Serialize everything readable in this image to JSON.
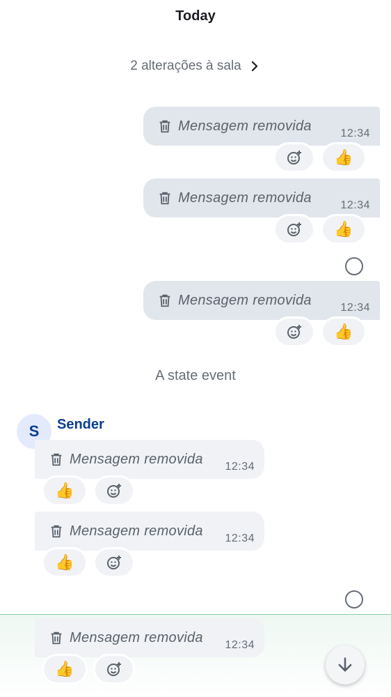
{
  "timeline": {
    "day_divider": "Today",
    "room_changes": "2 alterações à sala",
    "state_event": "A state event",
    "sender_name": "Sender",
    "sender_initial": "S"
  },
  "messages": [
    {
      "text": "Mensagem removida",
      "time": "12:34",
      "reaction": "👍"
    },
    {
      "text": "Mensagem removida",
      "time": "12:34",
      "reaction": "👍"
    },
    {
      "text": "Mensagem removida",
      "time": "12:34",
      "reaction": "👍"
    },
    {
      "text": "Mensagem removida",
      "time": "12:34",
      "reaction": "👍"
    },
    {
      "text": "Mensagem removida",
      "time": "12:34",
      "reaction": "👍"
    },
    {
      "text": "Mensagem removida",
      "time": "12:34",
      "reaction": "👍"
    }
  ],
  "icons": {
    "deleted": "trash-icon",
    "add_reaction": "add-reaction-icon",
    "chevron": "chevron-right-icon",
    "scroll": "arrow-down-icon"
  },
  "colors": {
    "sender": "#0c3e91",
    "bubble_outgoing": "#e1e6ec",
    "bubble_incoming": "#f0f2f5",
    "secondary_text": "#656d77"
  }
}
